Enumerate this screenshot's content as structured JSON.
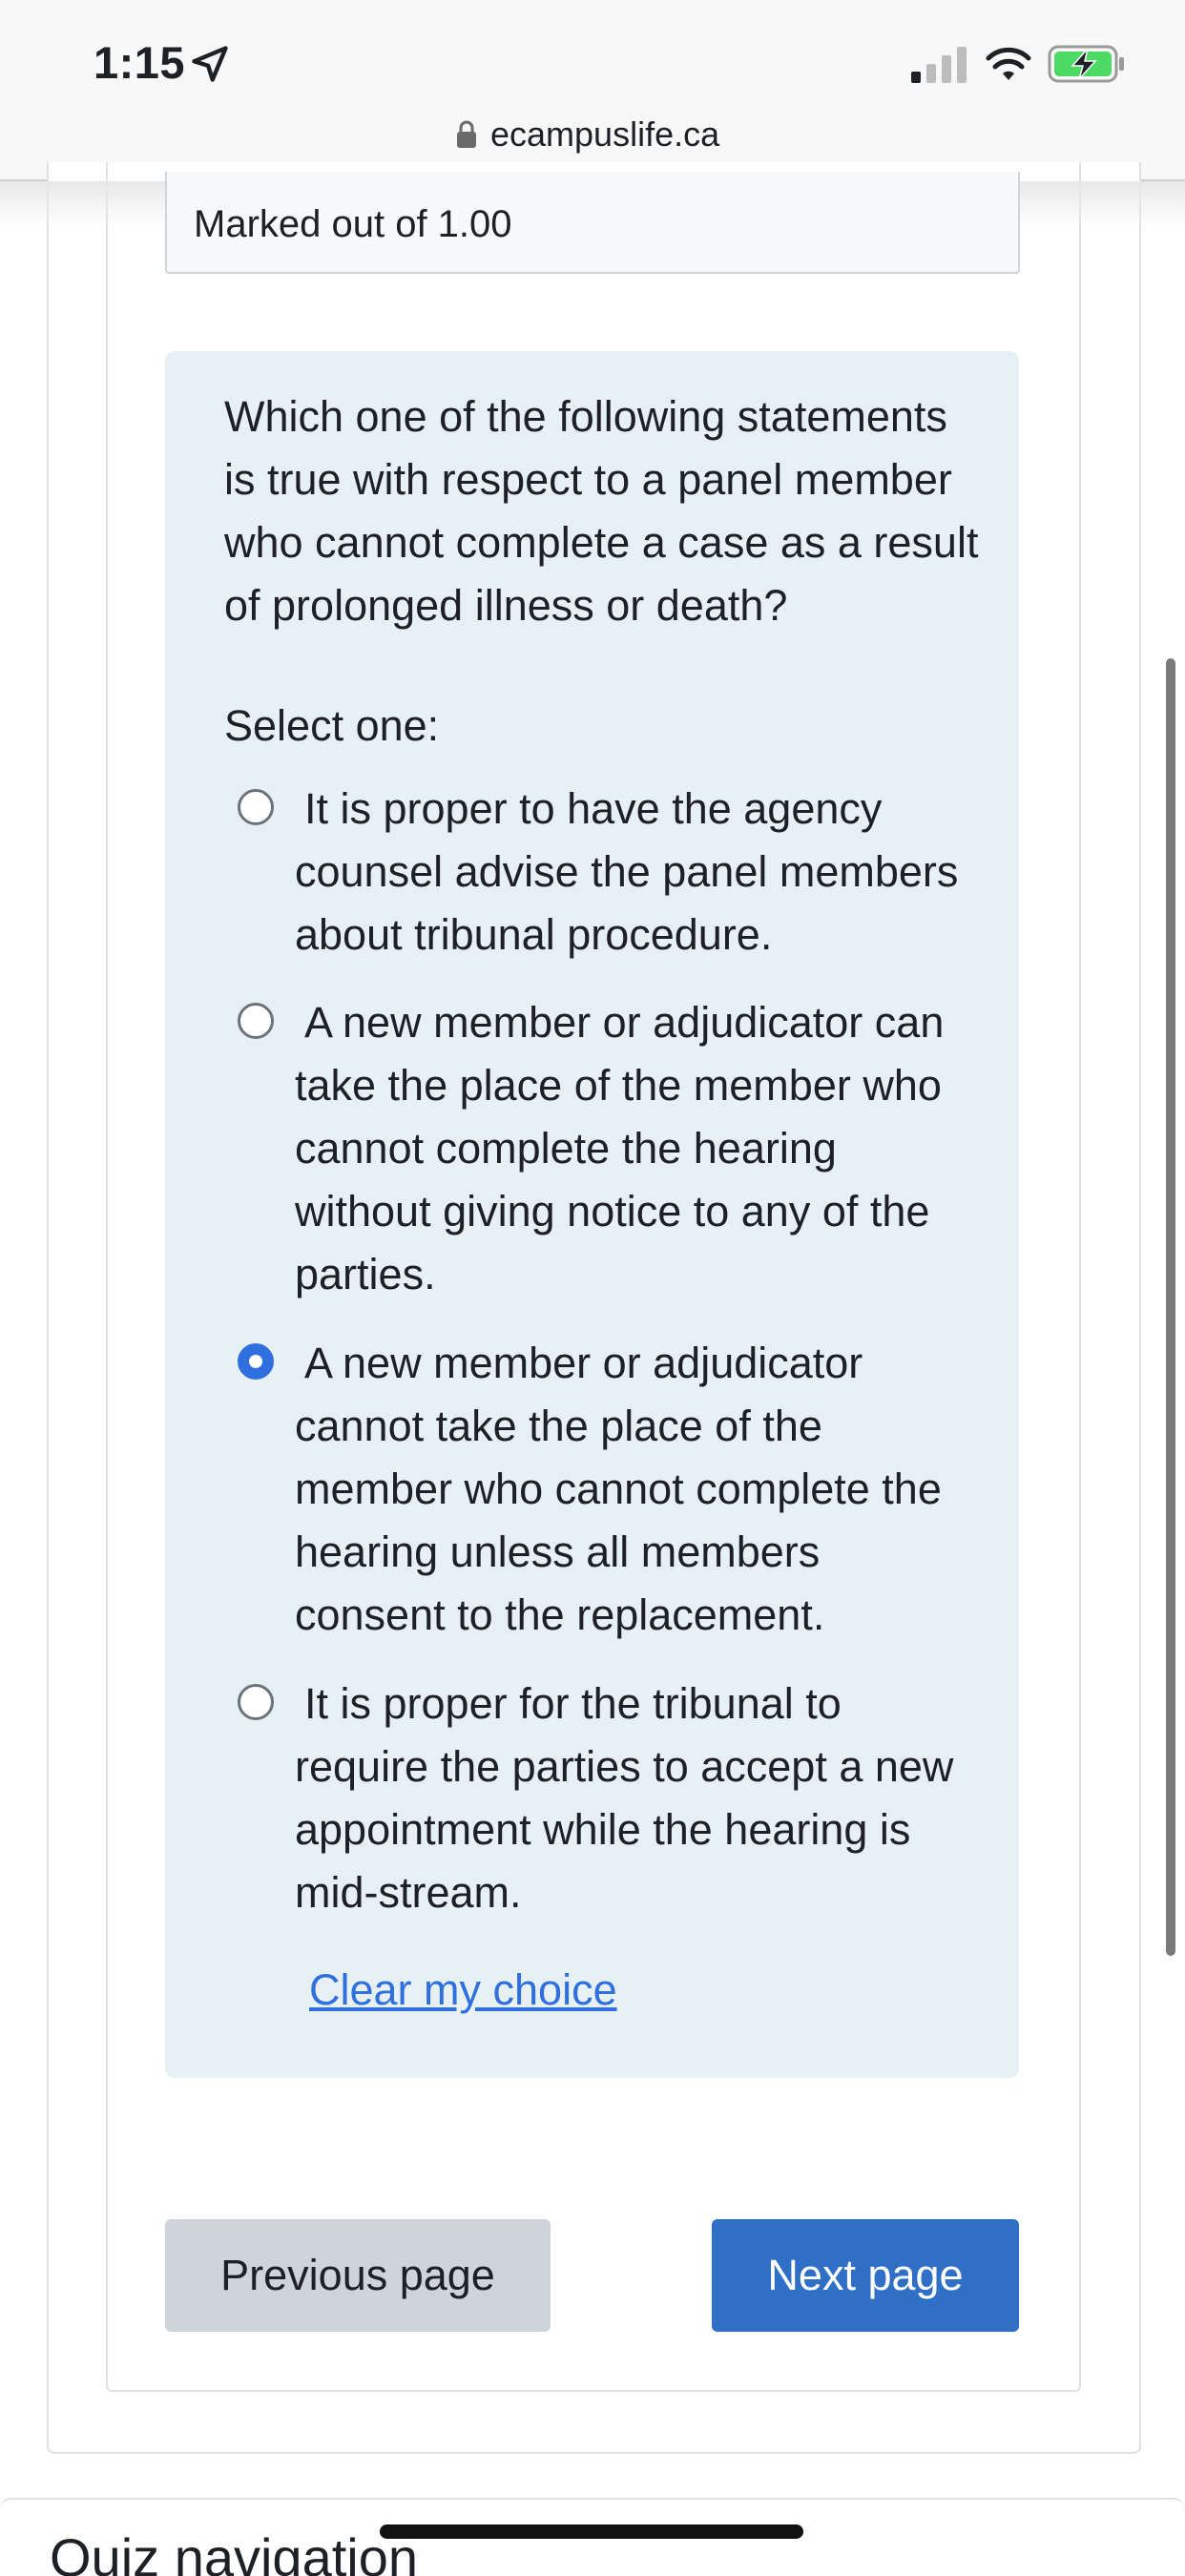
{
  "status_bar": {
    "time": "1:15",
    "icons": [
      "location-arrow-icon",
      "cellular-signal-icon",
      "wifi-icon",
      "battery-charging-icon"
    ]
  },
  "browser": {
    "url": "ecampuslife.ca",
    "lock_icon": "lock-icon"
  },
  "quiz": {
    "marked_out_of": "Marked out of 1.00",
    "question_text": "Which one of the following statements is true with respect to a panel member who cannot complete a case as a result of prolonged illness or death?",
    "select_one_label": "Select one:",
    "options": [
      {
        "label": "It is proper to have the agency counsel advise the panel members about tribunal procedure.",
        "selected": false
      },
      {
        "label": "A new member or adjudicator can take the place of the member who cannot complete the hearing without giving notice to any of the parties.",
        "selected": false
      },
      {
        "label": "A new member or adjudicator cannot take the place of the member who cannot complete the hearing unless all members consent to the replacement.",
        "selected": true
      },
      {
        "label": "It is proper for the tribunal to require the parties to accept a new appointment while the hearing is mid-stream.",
        "selected": false
      }
    ],
    "clear_choice_label": "Clear my choice"
  },
  "navigation": {
    "previous_label": "Previous page",
    "next_label": "Next page"
  },
  "bottom_section": {
    "heading": "Quiz navigation"
  },
  "colors": {
    "accent": "#2f6fde",
    "next_button": "#2f6fc5",
    "question_background": "#e7f1f3",
    "previous_button": "#ced4da"
  }
}
